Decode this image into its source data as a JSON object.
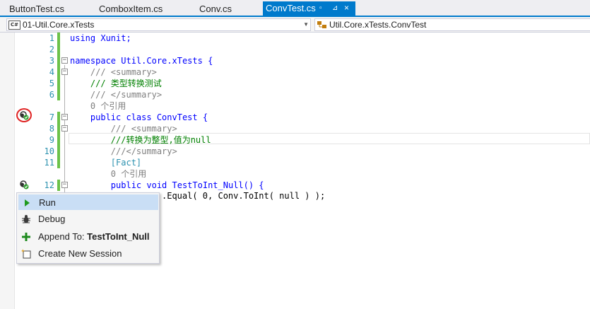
{
  "tabs": [
    {
      "label": "ButtonTest.cs",
      "active": false
    },
    {
      "label": "ComboxItem.cs",
      "active": false
    },
    {
      "label": "Conv.cs",
      "active": false
    },
    {
      "label": "ConvTest.cs",
      "active": true
    }
  ],
  "navbar": {
    "project_combo": "01-Util.Core.xTests",
    "class_combo": "Util.Core.xTests.ConvTest",
    "project_icon_text": "C#"
  },
  "editor": {
    "lines": [
      {
        "num": "1",
        "text": "using Xunit;"
      },
      {
        "num": "2",
        "text": ""
      },
      {
        "num": "3",
        "text": "namespace Util.Core.xTests {"
      },
      {
        "num": "4",
        "text": "    /// <summary>"
      },
      {
        "num": "5",
        "text": "    /// 类型转换测试"
      },
      {
        "num": "6",
        "text": "    /// </summary>"
      },
      {
        "num": "",
        "text": "    0 个引用"
      },
      {
        "num": "7",
        "text": "    public class ConvTest {"
      },
      {
        "num": "8",
        "text": "        /// <summary>"
      },
      {
        "num": "9",
        "text": "        ///转换为整型,值为null"
      },
      {
        "num": "10",
        "text": "        ///</summary>"
      },
      {
        "num": "11",
        "text": "        [Fact]"
      },
      {
        "num": "",
        "text": "        0 个引用"
      },
      {
        "num": "12",
        "text": "        public void TestToInt_Null() {"
      },
      {
        "num": "",
        "text": ".Equal( 0, Conv.ToInt( null ) );"
      }
    ]
  },
  "context_menu": {
    "items": [
      {
        "label": "Run",
        "icon": "play-icon"
      },
      {
        "label": "Debug",
        "icon": "bug-icon"
      },
      {
        "label_prefix": "Append To: ",
        "label_bold": "TestToInt_Null",
        "icon": "plus-icon"
      },
      {
        "label": "Create New Session",
        "icon": "new-session-icon"
      }
    ]
  },
  "colors": {
    "accent": "#007acc",
    "keyword": "#0000ff",
    "comment": "#008000",
    "type": "#2b91af",
    "menu_hover": "#c9def5"
  }
}
